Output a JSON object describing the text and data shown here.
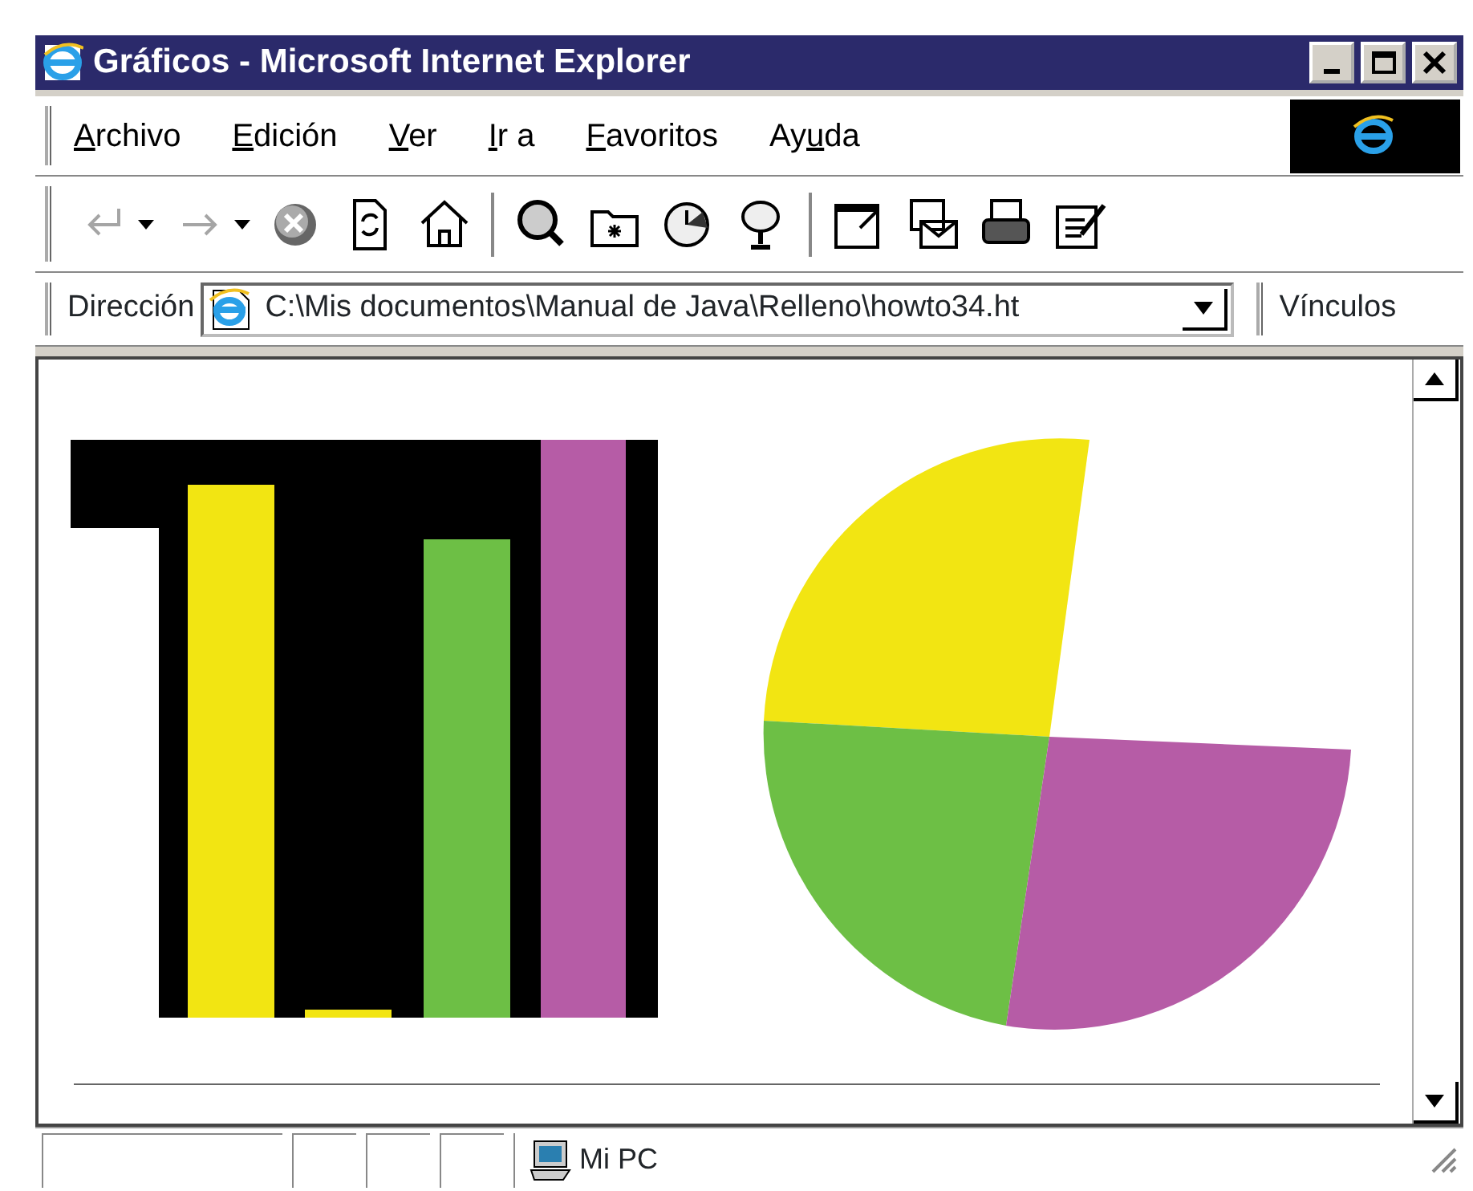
{
  "window": {
    "title": "Gráficos - Microsoft Internet Explorer"
  },
  "menu": [
    {
      "key": "A",
      "after": "rchivo"
    },
    {
      "key": "E",
      "after": "dición"
    },
    {
      "key": "V",
      "after": "er"
    },
    {
      "key": "I",
      "after": "r a"
    },
    {
      "key": "F",
      "after": "avoritos"
    },
    {
      "before": "Ay",
      "key": "u",
      "after": "da"
    }
  ],
  "toolbar": {
    "groups": [
      [
        {
          "disabled": true,
          "dropdown": true
        },
        {
          "disabled": true,
          "dropdown": true
        },
        {
          "disabled": false,
          "dropdown": false
        },
        {
          "disabled": false,
          "dropdown": false
        },
        {
          "disabled": false,
          "dropdown": false
        }
      ],
      [
        {
          "disabled": false,
          "dropdown": false
        },
        {
          "disabled": false,
          "dropdown": false
        },
        {
          "disabled": false,
          "dropdown": false
        },
        {
          "disabled": false,
          "dropdown": false
        }
      ],
      [
        {
          "disabled": false,
          "dropdown": false
        },
        {
          "disabled": false,
          "dropdown": false
        },
        {
          "disabled": false,
          "dropdown": false
        },
        {
          "disabled": false,
          "dropdown": false
        }
      ]
    ]
  },
  "address": {
    "label": "Dirección",
    "value": "C:\\Mis documentos\\Manual de Java\\Relleno\\howto34.ht",
    "links": "Vínculos"
  },
  "status_bar": {
    "zone": "Mi PC"
  }
}
